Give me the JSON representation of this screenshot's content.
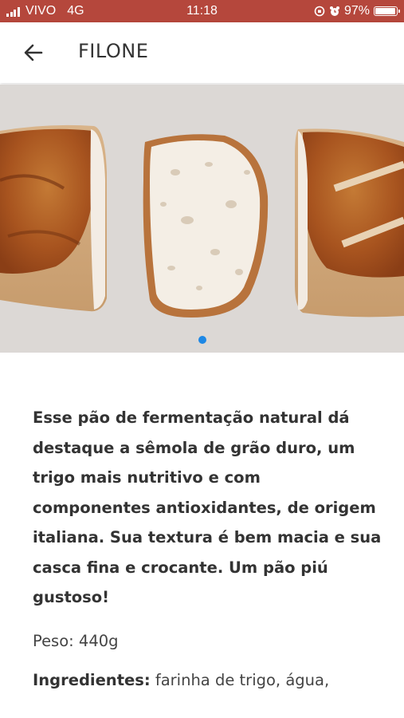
{
  "status_bar": {
    "carrier": "VIVO",
    "network": "4G",
    "time": "11:18",
    "battery_percent": "97%",
    "battery_level": 0.97
  },
  "app_bar": {
    "title": "FILONE",
    "back_icon": "arrow-left-icon"
  },
  "carousel": {
    "image": "sliced-sourdough-bread-photo",
    "page_count": 1,
    "active_index": 0,
    "indicator_color": "#1e88e5"
  },
  "product": {
    "description": "Esse pão de fermentação natural dá destaque a sêmola de grão duro, um trigo mais nutritivo e com componentes antioxidantes, de origem italiana. Sua textura é bem macia e sua casca fina e crocante. Um pão piú gustoso!",
    "weight": "Peso: 440g",
    "ingredients_label": "Ingredientes:",
    "ingredients_text": "farinha de trigo, água,"
  },
  "colors": {
    "status_bar": "#b5473c",
    "text": "#333333"
  }
}
